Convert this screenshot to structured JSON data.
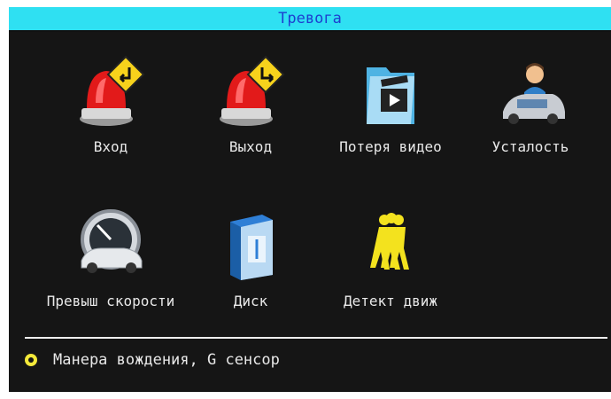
{
  "window": {
    "title": "Тревога"
  },
  "items": [
    {
      "label": "Вход",
      "icon": "alarm-input-icon"
    },
    {
      "label": "Выход",
      "icon": "alarm-output-icon"
    },
    {
      "label": "Потеря видео",
      "icon": "video-loss-icon"
    },
    {
      "label": "Усталость",
      "icon": "driver-fatigue-icon"
    },
    {
      "label": "Превыш скорости",
      "icon": "speedometer-car-icon"
    },
    {
      "label": "Диск",
      "icon": "disk-icon"
    },
    {
      "label": "Детект движ",
      "icon": "motion-detect-icon"
    }
  ],
  "footer": {
    "option_label": "Манера вождения, G сенсор",
    "option_icon": "radio-selected-icon"
  },
  "colors": {
    "title_bar": "#2fe0f2",
    "title_text": "#1d3fd0",
    "background": "#151515",
    "text": "#e8e8e8",
    "accent": "#f4e93a"
  }
}
